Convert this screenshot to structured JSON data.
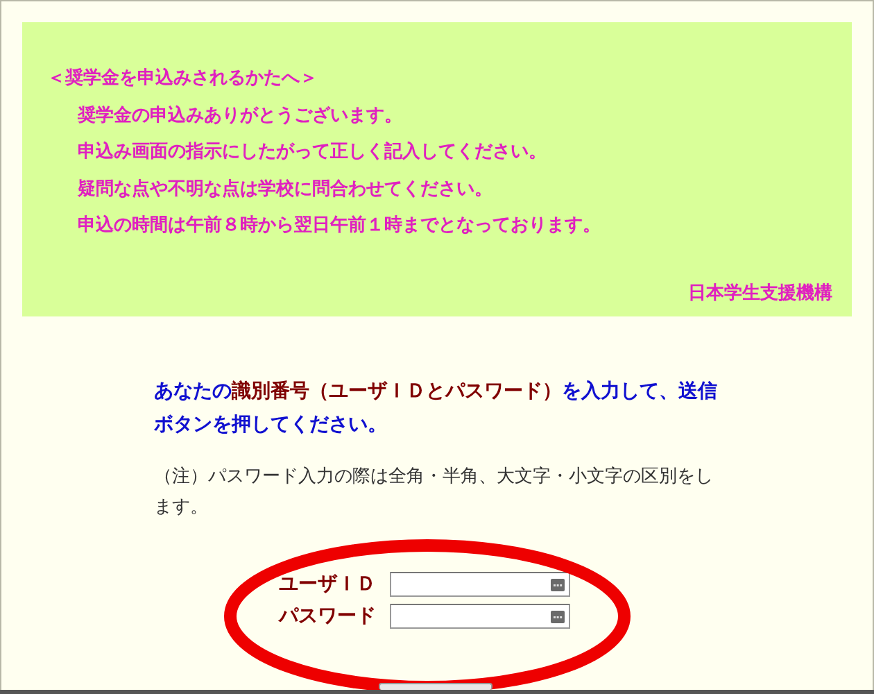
{
  "notice": {
    "heading": "＜奨学金を申込みされるかたへ＞",
    "lines": [
      "奨学金の申込みありがとうございます。",
      "申込み画面の指示にしたがって正しく記入してください。",
      "疑問な点や不明な点は学校に問合わせてください。",
      "申込の時間は午前８時から翌日午前１時までとなっております。"
    ],
    "signature": "日本学生支援機構"
  },
  "instruction": {
    "parts": [
      {
        "text": "あなたの",
        "emphasis": false
      },
      {
        "text": "識別番号（ユーザＩＤとパスワード）",
        "emphasis": true
      },
      {
        "text": "を入力して、送信ボタンを押してください。",
        "emphasis": false
      }
    ]
  },
  "note": "（注）パスワード入力の際は全角・半角、大文字・小文字の区別をします。",
  "fields": [
    {
      "label": "ユーザＩＤ"
    },
    {
      "label": "パスワード"
    }
  ],
  "highlight": {
    "shown": true
  }
}
